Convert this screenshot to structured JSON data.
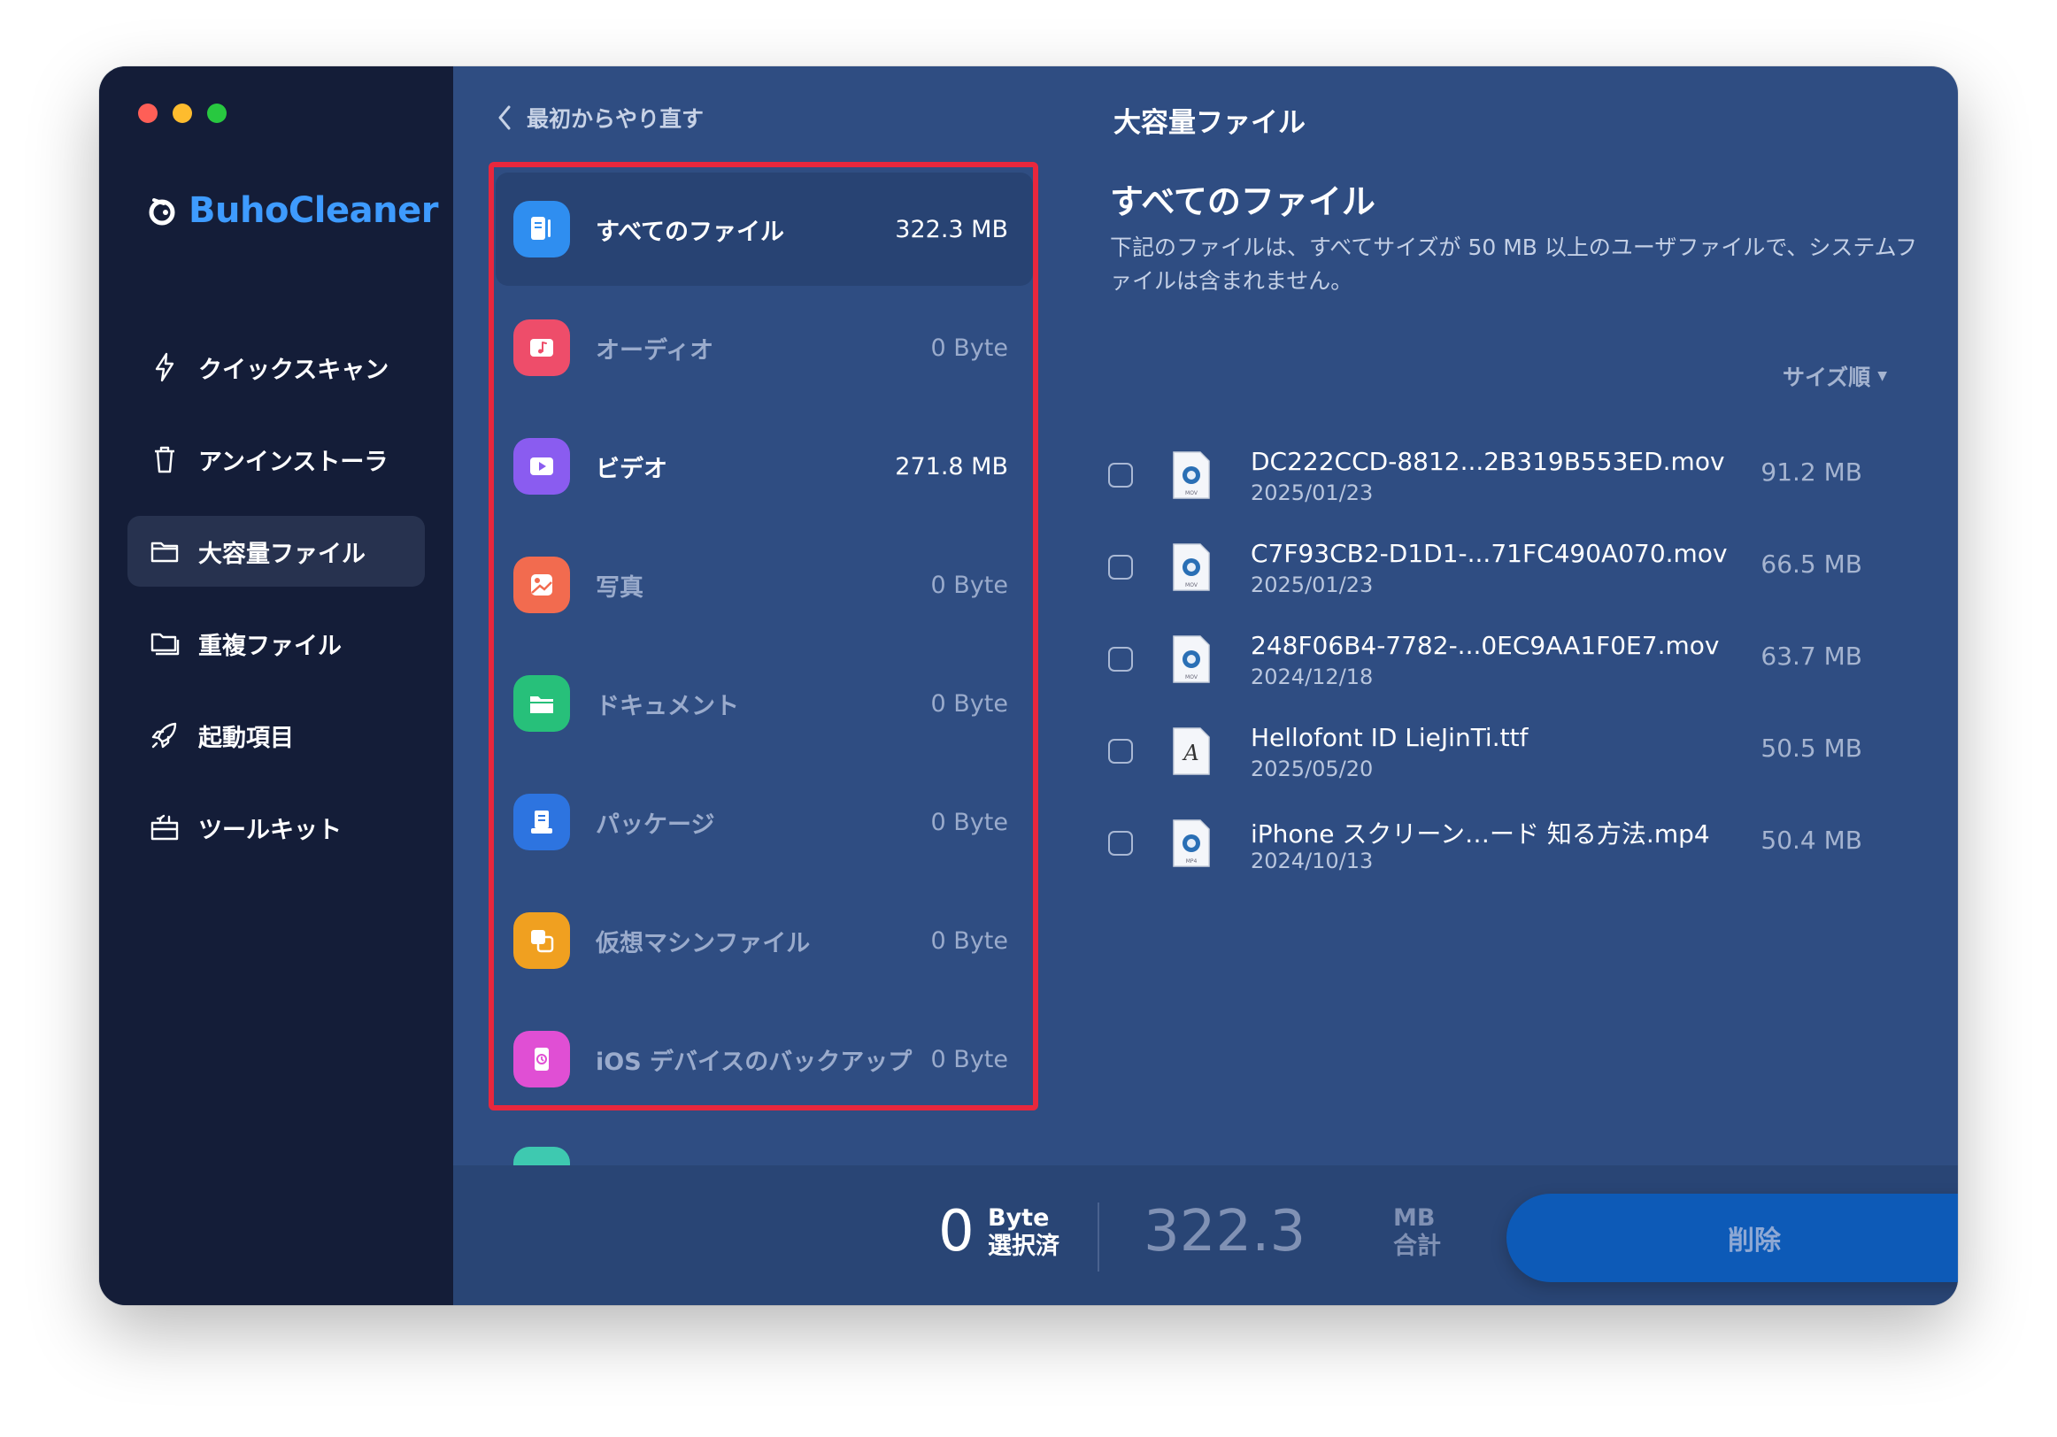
{
  "app": {
    "name": "BuhoCleaner"
  },
  "sidebar": {
    "items": [
      {
        "label": "クイックスキャン",
        "icon": "bolt-icon"
      },
      {
        "label": "アンインストーラ",
        "icon": "trash-icon"
      },
      {
        "label": "大容量ファイル",
        "icon": "folder-icon",
        "active": true
      },
      {
        "label": "重複ファイル",
        "icon": "duplicate-folder-icon"
      },
      {
        "label": "起動項目",
        "icon": "rocket-icon"
      },
      {
        "label": "ツールキット",
        "icon": "toolkit-icon"
      }
    ]
  },
  "back": {
    "label": "最初からやり直す"
  },
  "categories": [
    {
      "label": "すべてのファイル",
      "size": "322.3 MB",
      "icon": "all-files-icon",
      "color": "#2f8ef0",
      "active": true
    },
    {
      "label": "オーディオ",
      "size": "0 Byte",
      "icon": "audio-icon",
      "color": "#ee4d6a"
    },
    {
      "label": "ビデオ",
      "size": "271.8 MB",
      "icon": "video-icon",
      "color": "#8a5cf0"
    },
    {
      "label": "写真",
      "size": "0 Byte",
      "icon": "photo-icon",
      "color": "#f26b4f"
    },
    {
      "label": "ドキュメント",
      "size": "0 Byte",
      "icon": "document-folder-icon",
      "color": "#27c07a"
    },
    {
      "label": "パッケージ",
      "size": "0 Byte",
      "icon": "package-icon",
      "color": "#2d74e0"
    },
    {
      "label": "仮想マシンファイル",
      "size": "0 Byte",
      "icon": "virtual-machine-icon",
      "color": "#f0a020"
    },
    {
      "label": "iOS デバイスのバックアップ",
      "size": "0 Byte",
      "icon": "ios-backup-icon",
      "color": "#e04fd4"
    }
  ],
  "panel": {
    "title": "大容量ファイル",
    "section_title": "すべてのファイル",
    "description": "下記のファイルは、すべてサイズが 50 MB 以上のユーザファイルで、システムファイルは含まれません。",
    "sort_label": "サイズ順"
  },
  "files": [
    {
      "name": "DC222CCD-8812...2B319B553ED.mov",
      "date": "2025/01/23",
      "size": "91.2 MB",
      "type": "mov"
    },
    {
      "name": "C7F93CB2-D1D1-...71FC490A070.mov",
      "date": "2025/01/23",
      "size": "66.5 MB",
      "type": "mov"
    },
    {
      "name": "248F06B4-7782-...0EC9AA1F0E7.mov",
      "date": "2024/12/18",
      "size": "63.7 MB",
      "type": "mov"
    },
    {
      "name": "Hellofont ID LieJinTi.ttf",
      "date": "2025/05/20",
      "size": "50.5 MB",
      "type": "font"
    },
    {
      "name": "iPhone スクリーン…ード 知る方法.mp4",
      "date": "2024/10/13",
      "size": "50.4 MB",
      "type": "mov"
    }
  ],
  "footer": {
    "selected_value": "0",
    "selected_unit": "Byte",
    "selected_label": "選択済",
    "total_value": "322.3",
    "total_unit": "MB",
    "total_label": "合計",
    "delete_label": "削除"
  },
  "colors": {
    "sidebar_bg": "#141d38",
    "main_bg": "#2f4d82",
    "accent": "#3e9bff",
    "highlight_border": "#e8273d",
    "delete_button": "#0d5ab7"
  }
}
